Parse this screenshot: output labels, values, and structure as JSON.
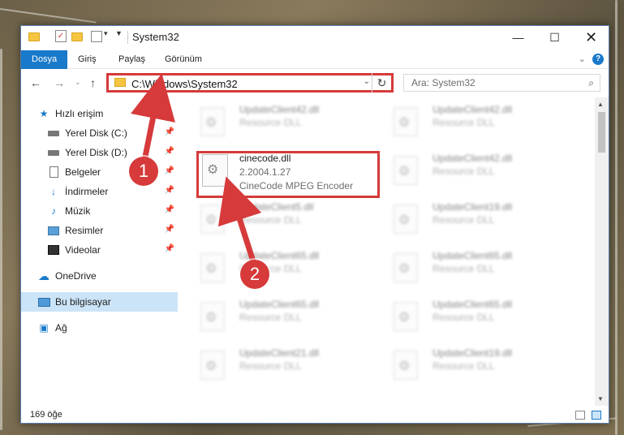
{
  "title": "System32",
  "ribbon": {
    "tabs": [
      "Dosya",
      "Giriş",
      "Paylaş",
      "Görünüm"
    ],
    "help": "?"
  },
  "nav": {
    "path": "C:\\Windows\\System32",
    "search_placeholder": "Ara: System32"
  },
  "sidebar": {
    "items": [
      {
        "label": "Hızlı erişim",
        "icon": "star-icon"
      },
      {
        "label": "Yerel Disk (C:)",
        "icon": "drive-icon"
      },
      {
        "label": "Yerel Disk (D:)",
        "icon": "drive-icon"
      },
      {
        "label": "Belgeler",
        "icon": "document-icon"
      },
      {
        "label": "İndirmeler",
        "icon": "download-icon"
      },
      {
        "label": "Müzik",
        "icon": "music-icon"
      },
      {
        "label": "Resimler",
        "icon": "pictures-icon"
      },
      {
        "label": "Videolar",
        "icon": "video-icon"
      },
      {
        "label": "OneDrive",
        "icon": "cloud-icon"
      },
      {
        "label": "Bu bilgisayar",
        "icon": "computer-icon"
      },
      {
        "label": "Ağ",
        "icon": "network-icon"
      }
    ]
  },
  "files": {
    "highlighted": {
      "name": "cinecode.dll",
      "version": "2.2004.1.27",
      "description": "CineCode MPEG Encoder"
    },
    "left": [
      {
        "name": "UpdateClient42.dll",
        "desc": "Resource DLL"
      },
      {
        "name": "UpdateClient5.dll",
        "desc": "Resource DLL"
      },
      {
        "name": "UpdateClient65.dll",
        "desc": "Resource DLL"
      },
      {
        "name": "UpdateClient65.dll",
        "desc": "Resource DLL"
      },
      {
        "name": "UpdateClient21.dll",
        "desc": "Resource DLL"
      }
    ],
    "right": [
      {
        "name": "UpdateClient42.dll",
        "desc": "Resource DLL"
      },
      {
        "name": "UpdateClient42.dll",
        "desc": "Resource DLL"
      },
      {
        "name": "UpdateClient19.dll",
        "desc": "Resource DLL"
      },
      {
        "name": "UpdateClient65.dll",
        "desc": "Resource DLL"
      },
      {
        "name": "UpdateClient65.dll",
        "desc": "Resource DLL"
      },
      {
        "name": "UpdateClient19.dll",
        "desc": "Resource DLL"
      }
    ]
  },
  "status": {
    "count": "169 öğe"
  },
  "annotations": {
    "badge1": "1",
    "badge2": "2"
  },
  "colors": {
    "accent": "#1979ca",
    "highlight": "#d63a3a",
    "selected": "#cce4f7"
  }
}
